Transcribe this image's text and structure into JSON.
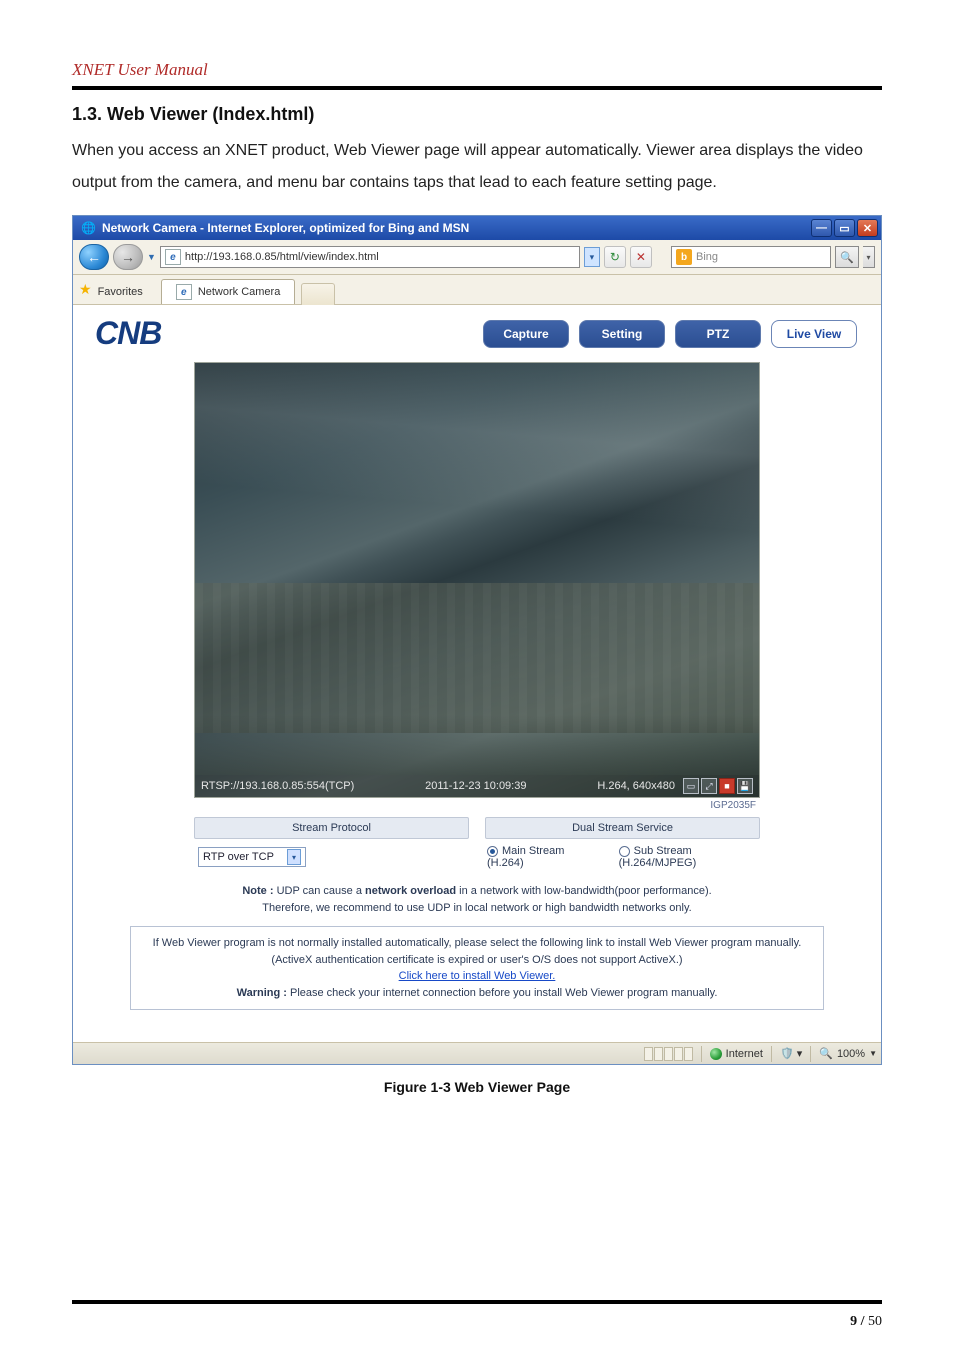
{
  "doc": {
    "header_title": "XNET User Manual",
    "section_heading": "1.3. Web Viewer (Index.html)",
    "intro_text": "  When you access an XNET product, Web Viewer page will appear automatically. Viewer area displays the video output from the camera, and menu bar contains taps that lead to each feature setting page.",
    "figure_caption": "Figure 1-3 Web Viewer Page",
    "page_num_bold": "9 /",
    "page_num_rest": " 50"
  },
  "ie": {
    "title": "Network Camera - Internet Explorer, optimized for Bing and MSN",
    "url": "http://193.168.0.85/html/view/index.html",
    "search_provider": "Bing",
    "favorites_label": "Favorites",
    "tab_label": "Network Camera",
    "status": {
      "zone": "Internet",
      "zoom": "100%"
    }
  },
  "app": {
    "logo": "CNB",
    "menu": {
      "capture": "Capture",
      "setting": "Setting",
      "ptz": "PTZ",
      "live": "Live View"
    },
    "osd": {
      "url": "RTSP://193.168.0.85:554(TCP)",
      "time": "2011-12-23 10:09:39",
      "codec": "H.264, 640x480"
    },
    "model": "IGP2035F",
    "panels": {
      "left": "Stream Protocol",
      "right": "Dual Stream Service"
    },
    "select_value": "RTP over TCP",
    "radios": {
      "main": "Main Stream (H.264)",
      "sub": "Sub Stream (H.264/MJPEG)"
    },
    "note": {
      "prefix": "Note : ",
      "l1a": "UDP can cause a ",
      "l1b": "network overload",
      "l1c": " in a network with low-bandwidth(poor performance).",
      "l2": "Therefore, we recommend to use UDP in local network or high bandwidth networks only."
    },
    "install": {
      "l1": "If Web Viewer program is not normally installed automatically, please select the following link to install Web Viewer program manually.",
      "l2": "(ActiveX authentication certificate is expired or user's O/S does not support ActiveX.)",
      "link": "Click here to install Web Viewer.",
      "warn_prefix": "Warning : ",
      "warn_text": "Please check your internet connection before you install Web Viewer program manually."
    }
  }
}
